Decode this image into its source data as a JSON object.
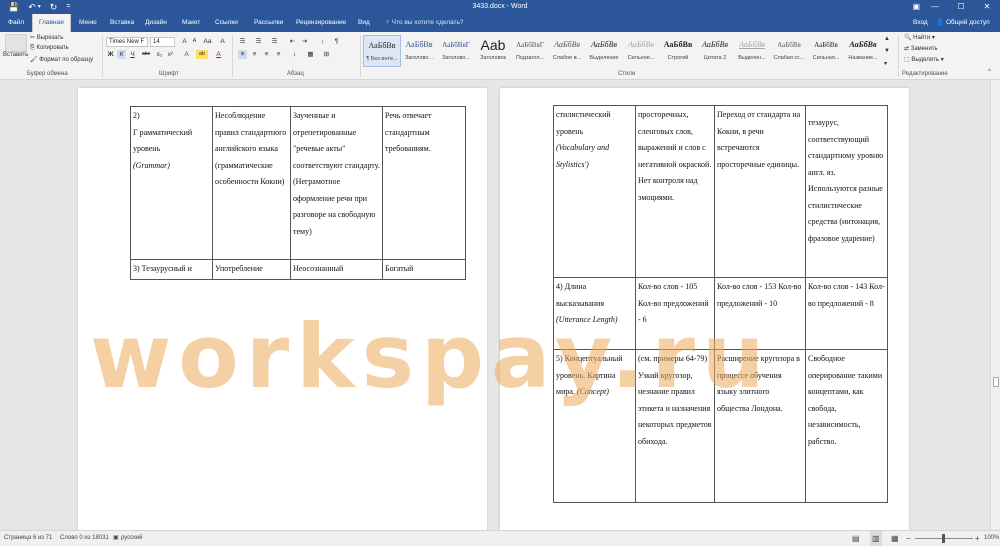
{
  "window": {
    "title": "3433.docx - Word",
    "controls": {
      "ribbon_options": "▣",
      "minimize": "—",
      "maximize": "☐",
      "close": "✕"
    }
  },
  "quick_access": {
    "save_icon": "💾",
    "undo_icon": "↶",
    "undo_arrow": "▾",
    "redo_icon": "↻",
    "customize": "="
  },
  "tabs": [
    "Файл",
    "Главная",
    "Меню",
    "Вставка",
    "Дизайн",
    "Макет",
    "Ссылки",
    "Рассылки",
    "Рецензирование",
    "Вид"
  ],
  "tell_me": "♀ Что вы хотите сделать?",
  "account": {
    "signin": "Вход",
    "share": "Общий доступ",
    "share_icon": "👤"
  },
  "ribbon": {
    "clipboard": {
      "paste": "Вставить",
      "cut": "Вырезать",
      "copy": "Копировать",
      "format_painter": "Формат по образцу",
      "label": "Буфер обмена"
    },
    "font": {
      "name": "Times New F",
      "size": "14",
      "label": "Шрифт",
      "buttons_row1": [
        "A",
        "A",
        "Aa",
        "A"
      ],
      "buttons_row2": [
        "Ж",
        "К",
        "Ч",
        "abc",
        "x₂",
        "x²",
        "A",
        "ab",
        "A"
      ]
    },
    "paragraph": {
      "label": "Абзац",
      "buttons_row1": [
        "☰",
        "☰",
        "☰",
        "⇤",
        "⇥",
        "↕",
        "¶"
      ],
      "buttons_row2": [
        "≡",
        "≡",
        "≡",
        "≡",
        "↕",
        "▦",
        "⊞"
      ]
    },
    "styles": {
      "label": "Стили",
      "items": [
        {
          "sample": "АаБбВв",
          "name": "¶ Без инте..."
        },
        {
          "sample": "АаБбВв",
          "name": "Заголово..."
        },
        {
          "sample": "АаБбВвГ",
          "name": "Заголово..."
        },
        {
          "sample": "Aab",
          "name": "Заголовок"
        },
        {
          "sample": "АаБбВвГ",
          "name": "Подзагол..."
        },
        {
          "sample": "АаБбВв",
          "name": "Слабое в..."
        },
        {
          "sample": "АаБбВв",
          "name": "Выделение"
        },
        {
          "sample": "АаБбВв",
          "name": "Сильное..."
        },
        {
          "sample": "АаБбВв",
          "name": "Строгий"
        },
        {
          "sample": "АаБбВв",
          "name": "Цитата 2"
        },
        {
          "sample": "АаБбВв",
          "name": "Выделен..."
        },
        {
          "sample": "АаБбВв",
          "name": "Слабая сс..."
        },
        {
          "sample": "АаБбВв",
          "name": "Сильная..."
        },
        {
          "sample": "АаБбВв",
          "name": "Название..."
        }
      ]
    },
    "editing": {
      "find": "Найти",
      "replace": "Заменить",
      "select": "Выделить",
      "label": "Редактирование"
    }
  },
  "document": {
    "page1": {
      "rows": [
        {
          "c1_num": "2)",
          "c1_text": "Г рамматический уровень",
          "c1_term": "(Grammar)",
          "c2": "Несоблюдение правил стандартного английского языка (грамматические особенности Кокни)",
          "c3": "Заученные и отрепетированные \"речевые акты\" соответствуют стандарту. (Неграмотное оформление речи при разговоре на свободную тему)",
          "c4": "Речь отвечает стандартным требованиям."
        },
        {
          "c1": "3) Тезаурусный и",
          "c2": "Употребление",
          "c3": "Неосознанный",
          "c4": "Богатый"
        }
      ]
    },
    "page2": {
      "rows": [
        {
          "c1_text": "стилистический уровень",
          "c1_term": "(Vocabulary and Stylistics')",
          "c2": "просторечных, сленговых слов, выражений и слов с негативной окраской. Нет контроля над эмоциями.",
          "c3": "Переход от стандарта на Кокни, в речи встречаются просторечные единицы.",
          "c4": "тезаурус, соответствующий стандартному уровню англ. яз. Используются разные стилистические средства (интонация, фразовое ударение)"
        },
        {
          "c1_text": "4) Длина высказывания",
          "c1_term": "(Utterance Length)",
          "c2": "Кол-во слов - 105 Кол-во предложений - 6",
          "c3": "Кол-во слов - 153 Кол-во предложений - 10",
          "c4": "Кол-во слов - 143 Кол-во предложений - 8"
        },
        {
          "c1_text": "5) Концептуальный уровень. Картина мира.",
          "c1_term": "(Concept)",
          "c2": "(см. примеры 64-79) Узкий кругозор, незнание правил этикета и назначения некоторых предметов обихода.",
          "c3": "Расширение кругозора в процессе обучения языку элитного общества Лондона.",
          "c4": "Свободное оперирование такими концептами, как свобода, независимость, рабство."
        }
      ]
    },
    "watermark": "workspay.ru"
  },
  "status": {
    "page": "Страница 6 из 71",
    "words": "Слово 0 из 18031",
    "proof_icon": "▣",
    "language": "русский",
    "views": [
      "▤",
      "▥",
      "▦"
    ],
    "zoom_minus": "−",
    "zoom_plus": "+",
    "zoom": "100%"
  }
}
